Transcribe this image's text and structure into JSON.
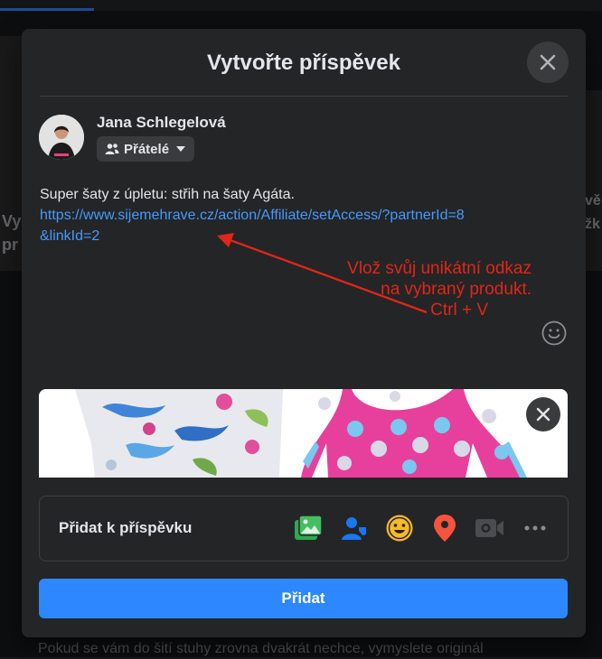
{
  "background": {
    "left_text": "Vy\npr",
    "right_text": "vě\nžk",
    "bottom_text": "Jste někdy zkusili ušít si i vlastní masín? To je výzva pro dnešní den :)\nPokud se vám do šití stuhy zrovna dvakrát nechce, vymyslete originál"
  },
  "modal": {
    "title": "Vytvořte příspěvek",
    "close_icon": "close-icon"
  },
  "author": {
    "name": "Jana Schlegelová",
    "privacy_label": "Přátelé",
    "privacy_icon": "friends-icon"
  },
  "post": {
    "text": "Super šaty z úpletu: střih na šaty Agáta.",
    "link": "https://www.sijemehrave.cz/action/Affiliate/setAccess/?partnerId=8&linkId=2"
  },
  "annotation": {
    "line1": "Vlož svůj unikátní odkaz",
    "line2": "na vybraný produkt.",
    "line3": "Ctrl + V",
    "color": "#e0261a"
  },
  "add_to_post": {
    "label": "Přidat k příspěvku",
    "tools": [
      "photo-video-icon",
      "tag-people-icon",
      "feeling-icon",
      "check-in-icon",
      "live-video-icon",
      "more-icon"
    ]
  },
  "submit": {
    "label": "Přidat",
    "color": "#2d88ff"
  }
}
